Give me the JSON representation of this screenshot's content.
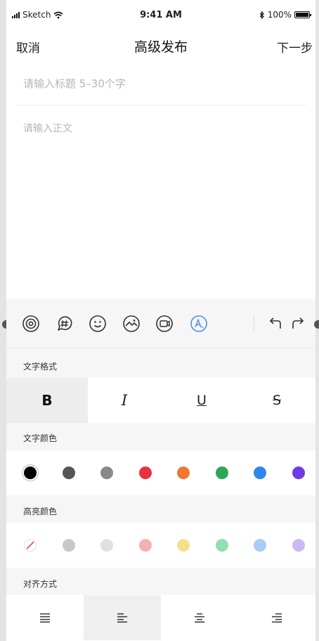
{
  "status_bar": {
    "carrier": "Sketch",
    "time": "9:41 AM",
    "battery_percent": "100%"
  },
  "nav": {
    "cancel": "取消",
    "title": "高级发布",
    "next": "下一步"
  },
  "editor": {
    "title_placeholder": "请输入标题 5–30个字",
    "body_placeholder": "请输入正文"
  },
  "toolbar": {
    "icons": [
      "settings-icon",
      "hashtag-icon",
      "emoji-icon",
      "image-icon",
      "video-icon",
      "text-format-icon",
      "undo-icon",
      "redo-icon"
    ],
    "active_icon": "text-format-icon",
    "accent_color": "#4a90e2"
  },
  "text_format": {
    "label": "文字格式",
    "buttons": [
      "B",
      "I",
      "U",
      "S"
    ],
    "active": "B"
  },
  "text_color": {
    "label": "文字颜色",
    "colors": [
      "#000000",
      "#555555",
      "#888888",
      "#e8323c",
      "#f07832",
      "#2aa85a",
      "#2f86f0",
      "#6c3ce6"
    ],
    "selected": 0
  },
  "highlight_color": {
    "label": "高亮颜色",
    "colors": [
      "none",
      "#c8c8c8",
      "#e0e0e0",
      "#f6b1b1",
      "#f5e08a",
      "#8fe0b2",
      "#a8cbf7",
      "#cdb8f5"
    ]
  },
  "alignment": {
    "label": "对齐方式",
    "options": [
      "justify-icon",
      "align-left-icon",
      "align-center-icon",
      "align-right-icon"
    ],
    "selected": 1
  }
}
